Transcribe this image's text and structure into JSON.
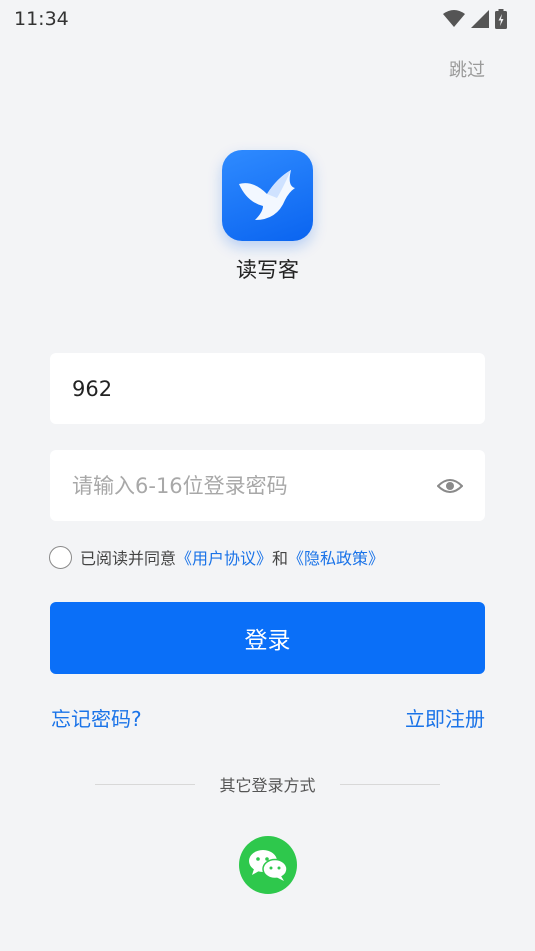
{
  "status_bar": {
    "time": "11:34"
  },
  "header": {
    "skip_label": "跳过"
  },
  "app": {
    "name": "读写客"
  },
  "form": {
    "username_value": "962",
    "password_placeholder": "请输入6-16位登录密码",
    "agreement": {
      "prefix": "已阅读并同意",
      "user_agreement": "《用户协议》",
      "and": "和",
      "privacy_policy": "《隐私政策》"
    },
    "login_label": "登录",
    "forgot_label": "忘记密码?",
    "register_label": "立即注册"
  },
  "other_login": {
    "label": "其它登录方式"
  },
  "colors": {
    "accent": "#0a6ff8",
    "link": "#1a73e8",
    "wechat": "#2ec84c"
  }
}
